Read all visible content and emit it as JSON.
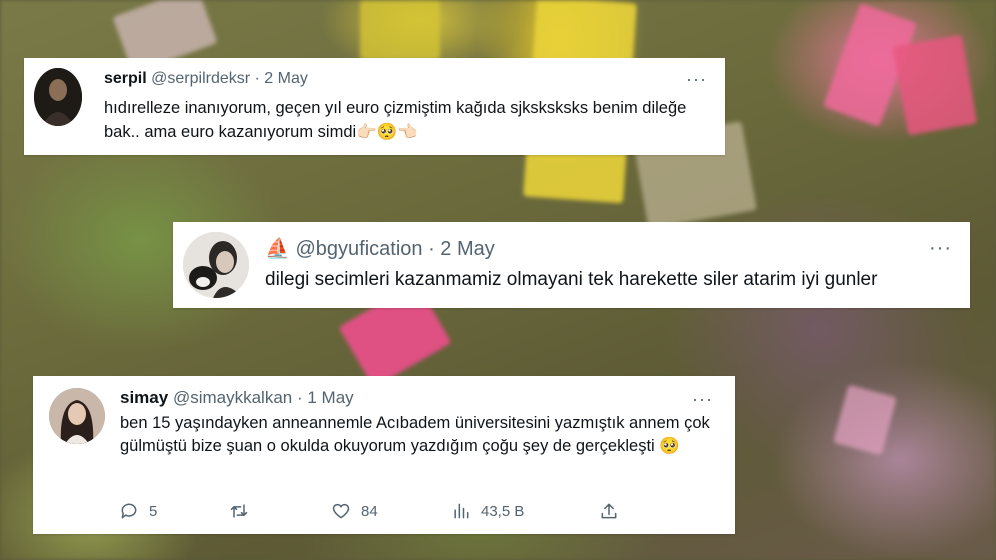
{
  "tweets": [
    {
      "name": "serpil",
      "handle": "@serpilrdeksr",
      "date": "· 2 May",
      "more": "···",
      "text": "hıdırelleze inanıyorum, geçen yıl euro çizmiştim kağıda sjksksksks benim dileğe bak.. ama euro kazanıyorum simdi👉🏻🥺👈🏻"
    },
    {
      "name_emoji": "⛵",
      "handle": "@bgyufication",
      "date": "· 2 May",
      "more": "···",
      "text": "dilegi secimleri kazanmamiz olmayani tek harekette siler atarim iyi gunler"
    },
    {
      "name": "simay",
      "handle": "@simaykkalkan",
      "date": "· 1 May",
      "more": "···",
      "text": "ben 15 yaşındayken anneannemle Acıbadem üniversitesini yazmıştık annem çok gülmüştü bize şuan o okulda okuyorum yazdığım çoğu şey de gerçekleşti 🥺",
      "actions": {
        "replies": "5",
        "retweets": "",
        "likes": "84",
        "views": "43,5 B"
      }
    }
  ]
}
